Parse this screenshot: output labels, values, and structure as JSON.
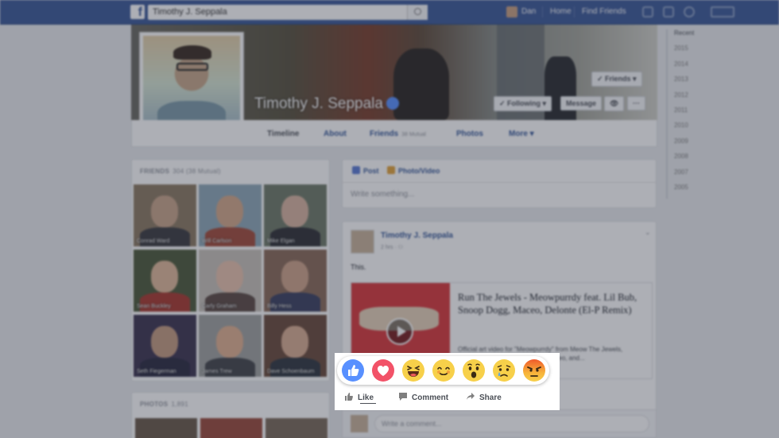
{
  "topbar": {
    "logo": "f",
    "search_value": "Timothy J. Seppala",
    "user_name": "Dan",
    "home": "Home",
    "find_friends": "Find Friends"
  },
  "timeline_years": [
    "Recent",
    "2015",
    "2014",
    "2013",
    "2012",
    "2011",
    "2010",
    "2009",
    "2008",
    "2007",
    "2005"
  ],
  "profile": {
    "name": "Timothy J. Seppala",
    "friends_button": "✓ Friends ▾",
    "following_button": "✓ Following ▾",
    "message_button": "Message",
    "more_button": "···"
  },
  "tabs": [
    {
      "label": "Timeline"
    },
    {
      "label": "About"
    },
    {
      "label": "Friends",
      "sub": "38 Mutual"
    },
    {
      "label": "Photos"
    },
    {
      "label": "More ▾"
    }
  ],
  "friends_card": {
    "title": "FRIENDS",
    "count": "304 (38 Mutual)",
    "items": [
      {
        "name": "Conrad Ward"
      },
      {
        "name": "Will Carlson"
      },
      {
        "name": "Mike Elgan"
      },
      {
        "name": "Sean Buckley"
      },
      {
        "name": "Carly Graham"
      },
      {
        "name": "Billy Hess"
      },
      {
        "name": "Seth Fiegerman"
      },
      {
        "name": "James Trew"
      },
      {
        "name": "Dave Schoenbaum"
      }
    ]
  },
  "photos_card": {
    "title": "PHOTOS",
    "count": "1,891"
  },
  "composer": {
    "post_tab": "Post",
    "photo_tab": "Photo/Video",
    "placeholder": "Write something..."
  },
  "post": {
    "author": "Timothy J. Seppala",
    "meta": "2 hrs · ⚇",
    "text": "This.",
    "link_title": "Run The Jewels - Meowpurrdy feat. Lil Bub, Snoop Dogg, Maceo, Delonte (El-P Remix)",
    "link_desc": "Official art video for \"Meowpurrdy\" from Meow The Jewels, featuring Lil Bub, Snoop Dogg, Maceo, and..."
  },
  "reactions": [
    {
      "name": "like",
      "color": "#5890ff"
    },
    {
      "name": "love",
      "color": "#f25268"
    },
    {
      "name": "haha",
      "color": "#f7d04a"
    },
    {
      "name": "yay",
      "color": "#f7d04a"
    },
    {
      "name": "wow",
      "color": "#f7d04a"
    },
    {
      "name": "sad",
      "color": "#f7d04a"
    },
    {
      "name": "angry",
      "color": "#f05a2b"
    }
  ],
  "actions": {
    "like": "Like",
    "comment": "Comment",
    "share": "Share"
  },
  "comment": {
    "placeholder": "Write a comment..."
  }
}
